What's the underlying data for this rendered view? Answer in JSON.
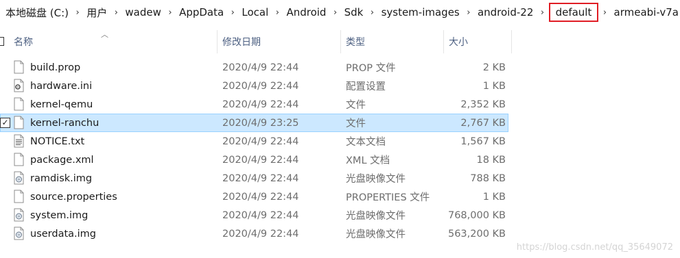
{
  "breadcrumb": {
    "items": [
      "本地磁盘 (C:)",
      "用户",
      "wadew",
      "AppData",
      "Local",
      "Android",
      "Sdk",
      "system-images",
      "android-22",
      "default",
      "armeabi-v7a"
    ],
    "separator": "›"
  },
  "columns": {
    "name": "名称",
    "date": "修改日期",
    "type": "类型",
    "size": "大小"
  },
  "files": [
    {
      "name": "build.prop",
      "date": "2020/4/9 22:44",
      "type": "PROP 文件",
      "size": "2 KB",
      "icon": "file-icon"
    },
    {
      "name": "hardware.ini",
      "date": "2020/4/9 22:44",
      "type": "配置设置",
      "size": "1 KB",
      "icon": "settings-file-icon"
    },
    {
      "name": "kernel-qemu",
      "date": "2020/4/9 22:44",
      "type": "文件",
      "size": "2,352 KB",
      "icon": "file-icon"
    },
    {
      "name": "kernel-ranchu",
      "date": "2020/4/9 23:25",
      "type": "文件",
      "size": "2,767 KB",
      "icon": "file-icon",
      "selected": true
    },
    {
      "name": "NOTICE.txt",
      "date": "2020/4/9 22:44",
      "type": "文本文档",
      "size": "1,567 KB",
      "icon": "text-file-icon"
    },
    {
      "name": "package.xml",
      "date": "2020/4/9 22:44",
      "type": "XML 文档",
      "size": "18 KB",
      "icon": "file-icon"
    },
    {
      "name": "ramdisk.img",
      "date": "2020/4/9 22:44",
      "type": "光盘映像文件",
      "size": "788 KB",
      "icon": "disc-image-icon"
    },
    {
      "name": "source.properties",
      "date": "2020/4/9 22:44",
      "type": "PROPERTIES 文件",
      "size": "1 KB",
      "icon": "file-icon"
    },
    {
      "name": "system.img",
      "date": "2020/4/9 22:44",
      "type": "光盘映像文件",
      "size": "768,000 KB",
      "icon": "disc-image-icon"
    },
    {
      "name": "userdata.img",
      "date": "2020/4/9 22:44",
      "type": "光盘映像文件",
      "size": "563,200 KB",
      "icon": "disc-image-icon"
    }
  ],
  "watermark": "https://blog.csdn.net/qq_35649072",
  "colors": {
    "selection_bg": "#cce8ff",
    "selection_border": "#99d1ff",
    "highlight_box": "#e01c24",
    "header_text": "#4d6082"
  }
}
